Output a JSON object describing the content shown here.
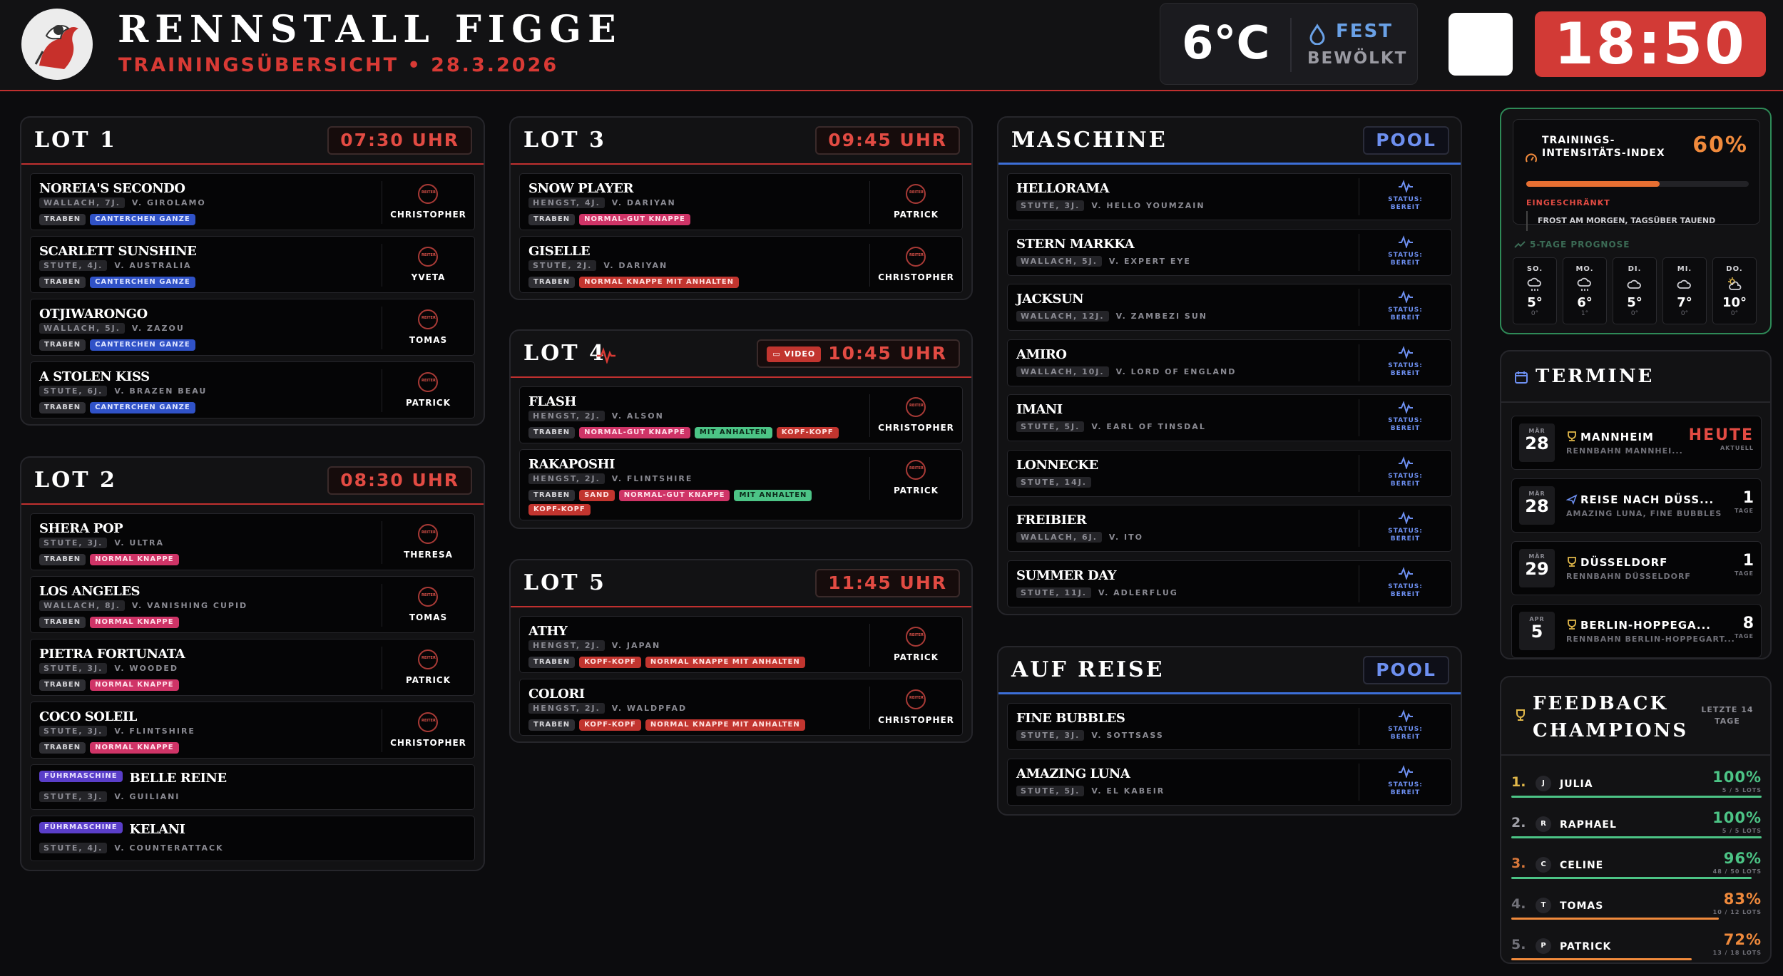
{
  "header": {
    "title": "RENNSTALL FIGGE",
    "subtitle": "TRAININGSÜBERSICHT • 28.3.2026",
    "temp": "6°C",
    "weather_line1": "FEST",
    "weather_line2": "BEWÖLKT",
    "clock": "18:50"
  },
  "colors": {
    "accent": "#d23a36",
    "pool": "#6d8ff0",
    "good": "#4cc486",
    "warn": "#f08a3c"
  },
  "lot1": {
    "title": "LOT 1",
    "time": "07:30 UHR",
    "horses": [
      {
        "name": "NOREIA'S SECONDO",
        "meta": "WALLACH, 7J.",
        "sire": "V. GIROLAMO",
        "tags": [
          "TRABEN",
          "CANTERCHEN GANZE"
        ],
        "rider": "CHRISTOPHER"
      },
      {
        "name": "SCARLETT SUNSHINE",
        "meta": "STUTE, 4J.",
        "sire": "V. AUSTRALIA",
        "tags": [
          "TRABEN",
          "CANTERCHEN GANZE"
        ],
        "rider": "YVETA"
      },
      {
        "name": "OTJIWARONGO",
        "meta": "WALLACH, 5J.",
        "sire": "V. ZAZOU",
        "tags": [
          "TRABEN",
          "CANTERCHEN GANZE"
        ],
        "rider": "TOMAS"
      },
      {
        "name": "A STOLEN KISS",
        "meta": "STUTE, 6J.",
        "sire": "V. BRAZEN BEAU",
        "tags": [
          "TRABEN",
          "CANTERCHEN GANZE"
        ],
        "rider": "PATRICK"
      }
    ]
  },
  "lot2": {
    "title": "LOT 2",
    "time": "08:30 UHR",
    "horses": [
      {
        "name": "SHERA POP",
        "meta": "STUTE, 3J.",
        "sire": "V. ULTRA",
        "tags": [
          "TRABEN",
          "NORMAL KNAPPE"
        ],
        "rider": "THERESA"
      },
      {
        "name": "LOS ANGELES",
        "meta": "WALLACH, 8J.",
        "sire": "V. VANISHING CUPID",
        "tags": [
          "TRABEN",
          "NORMAL KNAPPE"
        ],
        "rider": "TOMAS"
      },
      {
        "name": "PIETRA FORTUNATA",
        "meta": "STUTE, 3J.",
        "sire": "V. WOODED",
        "tags": [
          "TRABEN",
          "NORMAL KNAPPE"
        ],
        "rider": "PATRICK"
      },
      {
        "name": "COCO SOLEIL",
        "meta": "STUTE, 3J.",
        "sire": "V. FLINTSHIRE",
        "tags": [
          "TRABEN",
          "NORMAL KNAPPE"
        ],
        "rider": "CHRISTOPHER"
      }
    ],
    "fuehrmaschine": [
      {
        "tag": "FÜHRMASCHINE",
        "name": "BELLE REINE",
        "meta": "STUTE, 3J.",
        "sire": "V. GUILIANI"
      },
      {
        "tag": "FÜHRMASCHINE",
        "name": "KELANI",
        "meta": "STUTE, 4J.",
        "sire": "V. COUNTERATTACK"
      }
    ]
  },
  "lot3": {
    "title": "LOT 3",
    "time": "09:45 UHR",
    "horses": [
      {
        "name": "SNOW PLAYER",
        "meta": "HENGST, 4J.",
        "sire": "V. DARIYAN",
        "tags": [
          "TRABEN",
          "NORMAL-GUT KNAPPE"
        ],
        "rider": "PATRICK"
      },
      {
        "name": "GISELLE",
        "meta": "STUTE, 2J.",
        "sire": "V. DARIYAN",
        "tags": [
          "TRABEN",
          "NORMAL KNAPPE MIT ANHALTEN"
        ],
        "rider": "CHRISTOPHER"
      }
    ]
  },
  "lot4": {
    "title": "LOT 4",
    "video": "VIDEO",
    "time": "10:45 UHR",
    "horses": [
      {
        "name": "FLASH",
        "meta": "HENGST, 2J.",
        "sire": "V. ALSON",
        "tags": [
          "TRABEN",
          "NORMAL-GUT KNAPPE",
          "MIT ANHALTEN",
          "KOPF-KOPF"
        ],
        "rider": "CHRISTOPHER"
      },
      {
        "name": "RAKAPOSHI",
        "meta": "HENGST, 2J.",
        "sire": "V. FLINTSHIRE",
        "tags": [
          "TRABEN",
          "SAND",
          "NORMAL-GUT KNAPPE",
          "MIT ANHALTEN",
          "KOPF-KOPF"
        ],
        "rider": "PATRICK"
      }
    ]
  },
  "lot5": {
    "title": "LOT 5",
    "time": "11:45 UHR",
    "horses": [
      {
        "name": "ATHY",
        "meta": "HENGST, 2J.",
        "sire": "V. JAPAN",
        "tags": [
          "TRABEN",
          "KOPF-KOPF",
          "NORMAL KNAPPE MIT ANHALTEN"
        ],
        "rider": "PATRICK"
      },
      {
        "name": "COLORI",
        "meta": "HENGST, 2J.",
        "sire": "V. WALDPFAD",
        "tags": [
          "TRABEN",
          "KOPF-KOPF",
          "NORMAL KNAPPE MIT ANHALTEN"
        ],
        "rider": "CHRISTOPHER"
      }
    ]
  },
  "rider_badge": "REITER",
  "maschine": {
    "title": "MASCHINE",
    "pool": "POOL",
    "status1": "STATUS:",
    "status2": "BEREIT",
    "horses": [
      {
        "name": "HELLORAMA",
        "meta": "STUTE, 3J.",
        "sire": "V. HELLO YOUMZAIN"
      },
      {
        "name": "STERN MARKKA",
        "meta": "WALLACH, 5J.",
        "sire": "V. EXPERT EYE"
      },
      {
        "name": "JACKSUN",
        "meta": "WALLACH, 12J.",
        "sire": "V. ZAMBEZI SUN"
      },
      {
        "name": "AMIRO",
        "meta": "WALLACH, 10J.",
        "sire": "V. LORD OF ENGLAND"
      },
      {
        "name": "IMANI",
        "meta": "STUTE, 5J.",
        "sire": "V. EARL OF TINSDAL"
      },
      {
        "name": "LONNECKE",
        "meta": "STUTE, 14J.",
        "sire": ""
      },
      {
        "name": "FREIBIER",
        "meta": "WALLACH, 6J.",
        "sire": "V. ITO"
      },
      {
        "name": "SUMMER DAY",
        "meta": "STUTE, 11J.",
        "sire": "V. ADLERFLUG"
      }
    ]
  },
  "reise": {
    "title": "AUF REISE",
    "pool": "POOL",
    "horses": [
      {
        "name": "FINE BUBBLES",
        "meta": "STUTE, 3J.",
        "sire": "V. SOTTSASS"
      },
      {
        "name": "AMAZING LUNA",
        "meta": "STUTE, 5J.",
        "sire": "V. EL KABEIR"
      }
    ]
  },
  "index": {
    "label": "TRAININGS-INTENSITÄTS-INDEX",
    "value": "60%",
    "level": 0.6,
    "status": "EINGESCHRÄNKT",
    "note": "FROST AM MORGEN, TAGSÜBER TAUEND",
    "forecast_title": "5-TAGE PROGNOSE",
    "days": [
      {
        "name": "SO.",
        "icon": "snow-cloud-icon",
        "hi": "5°",
        "lo": "0°"
      },
      {
        "name": "MO.",
        "icon": "snow-cloud-icon",
        "hi": "6°",
        "lo": "1°"
      },
      {
        "name": "DI.",
        "icon": "cloud-icon",
        "hi": "5°",
        "lo": "0°"
      },
      {
        "name": "MI.",
        "icon": "cloud-icon",
        "hi": "7°",
        "lo": "0°"
      },
      {
        "name": "DO.",
        "icon": "sun-cloud-icon",
        "hi": "10°",
        "lo": "0°"
      }
    ]
  },
  "termine": {
    "title": "TERMINE",
    "events": [
      {
        "month": "MÄR",
        "day": "28",
        "icon": "trophy-icon",
        "title": "MANNHEIM",
        "sub": "RENNBAHN MANNHEI...",
        "right": "HEUTE",
        "right_small": "AKTUELL"
      },
      {
        "month": "MÄR",
        "day": "28",
        "icon": "plane-icon",
        "title": "REISE NACH DÜSS...",
        "sub": "AMAZING LUNA, FINE BUBBLES",
        "right": "1",
        "right_small": "TAGE"
      },
      {
        "month": "MÄR",
        "day": "29",
        "icon": "trophy-icon",
        "title": "DÜSSELDORF",
        "sub": "RENNBAHN DÜSSELDORF",
        "right": "1",
        "right_small": "TAGE"
      },
      {
        "month": "APR",
        "day": "5",
        "icon": "trophy-icon",
        "title": "BERLIN-HOPPEGA...",
        "sub": "RENNBAHN BERLIN-HOPPEGART...",
        "right": "8",
        "right_small": "TAGE"
      }
    ]
  },
  "feedback": {
    "title": "FEEDBACK CHAMPIONS",
    "period": "LETZTE 14 TAGE",
    "entries": [
      {
        "rank": "1.",
        "initial": "J",
        "name": "JULIA",
        "pct": "100%",
        "lots": "5 / 5 LOTS",
        "ratio": 1.0
      },
      {
        "rank": "2.",
        "initial": "R",
        "name": "RAPHAEL",
        "pct": "100%",
        "lots": "5 / 5 LOTS",
        "ratio": 1.0
      },
      {
        "rank": "3.",
        "initial": "C",
        "name": "CELINE",
        "pct": "96%",
        "lots": "48 / 50 LOTS",
        "ratio": 0.96
      },
      {
        "rank": "4.",
        "initial": "T",
        "name": "TOMAS",
        "pct": "83%",
        "lots": "10 / 12 LOTS",
        "ratio": 0.83
      },
      {
        "rank": "5.",
        "initial": "P",
        "name": "PATRICK",
        "pct": "72%",
        "lots": "13 / 18 LOTS",
        "ratio": 0.72
      }
    ]
  }
}
